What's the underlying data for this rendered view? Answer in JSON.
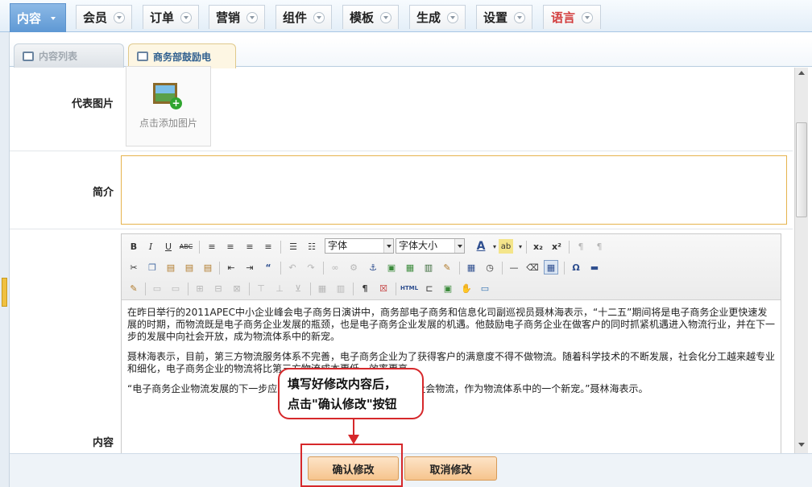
{
  "nav": {
    "items": [
      "内容",
      "会员",
      "订单",
      "营销",
      "组件",
      "模板",
      "生成",
      "设置",
      "语言"
    ],
    "active_index": 0,
    "highlight_item": "语言"
  },
  "subtabs": [
    "内容列表",
    "商务部鼓励电"
  ],
  "form": {
    "image_label": "代表图片",
    "image_add_caption": "点击添加图片",
    "summary_label": "简介",
    "summary_value": "",
    "content_label": "内容"
  },
  "editor": {
    "font_select": "字体",
    "size_select": "字体大小",
    "paragraphs": [
      "在昨日举行的2011APEC中小企业峰会电子商务日演讲中，商务部电子商务和信息化司副巡视员聂林海表示，“十二五”期间将是电子商务企业更快速发展的时期，而物流既是电子商务企业发展的瓶颈，也是电子商务企业发展的机遇。他鼓励电子商务企业在做客户的同时抓紧机遇进入物流行业，并在下一步的发展中向社会开放，成为物流体系中的新宠。",
      "聂林海表示，目前，第三方物流服务体系不完善，电子商务企业为了获得客户的满意度不得不做物流。随着科学技术的不断发展，社会化分工越来越专业和细化，电子商务企业的物流将比第三方物流成本更低、效率更高。",
      "“电子商务企业物流发展的下一步应",
      "三方社会物流，作为物流体系中的一个新宠。”聂林海表示。"
    ]
  },
  "buttons": {
    "confirm": "确认修改",
    "cancel": "取消修改"
  },
  "callout": {
    "line1": "填写好修改内容后，",
    "line2": "点击\"确认修改\"按钮"
  },
  "colors": {
    "accent_red": "#d6282b",
    "nav_active": "#5e98d4",
    "button_orange": "#f6c48d"
  }
}
